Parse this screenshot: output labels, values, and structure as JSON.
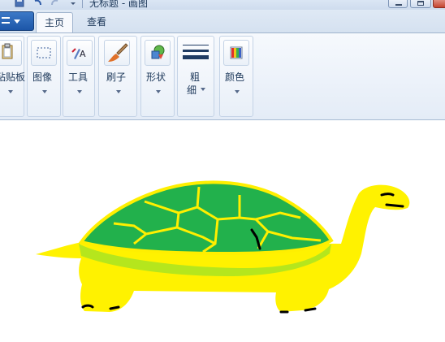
{
  "window": {
    "title": "无标题 - 画图",
    "controls": [
      "minimize",
      "maximize",
      "close"
    ]
  },
  "quick_access": {
    "icons": [
      "save-icon",
      "undo-icon",
      "redo-icon",
      "customize-icon"
    ]
  },
  "tabs": [
    {
      "label": "主页",
      "active": true
    },
    {
      "label": "查看",
      "active": false
    }
  ],
  "ribbon": {
    "clipboard_label": "粘贴板",
    "image_label": "图像",
    "tools_label": "工具",
    "brushes_label": "刷子",
    "shapes_label": "形状",
    "size_label_line1": "粗",
    "size_label_line2": "细",
    "colors_label": "颜色"
  },
  "colors": {
    "shell": "#2db04a",
    "shell_outline": "#ffef00",
    "body": "#fff200",
    "belly": "#b5e61d",
    "ink": "#000000"
  }
}
